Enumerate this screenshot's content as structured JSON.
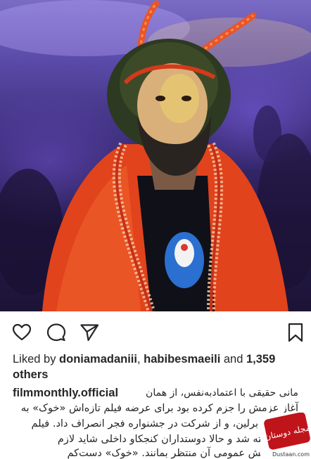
{
  "post": {
    "image_alt": "Actor in red costume with antenna headband",
    "likes": {
      "prefix": "Liked by ",
      "user1": "doniamadaniii",
      "sep": ", ",
      "user2": "habibesmaeili",
      "and": " and ",
      "count": "1,359",
      "suffix": "others"
    },
    "caption": {
      "username": "filmmonthly.official",
      "lines": [
        "مانی حقیقی با اعتمادبه‌نفس، از همان",
        "آغاز عزمش را جزم کرده بود برای عرضه فیلم تازه‌اش «خوک» به",
        "جشنواره برلین، و از شرکت در جشنواره فجر انصراف داد. فیلم",
        "هم پذیرفته شد و حالا دوستداران کنجکاو داخلی شاید لازم",
        "برای نمایش عمومی آن منتظر بمانند. «خوک» دست‌کم"
      ]
    }
  },
  "watermark": {
    "text": "Dustaan.com",
    "logo_text": "مجله دوستان"
  },
  "icons": {
    "like": "heart-icon",
    "comment": "comment-icon",
    "share": "send-icon",
    "save": "bookmark-icon"
  },
  "colors": {
    "text": "#262626",
    "jacket": "#e1431c",
    "watermark_red": "#c0141b"
  }
}
